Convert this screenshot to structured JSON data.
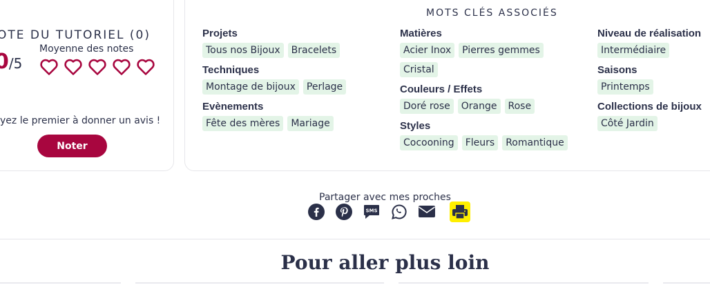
{
  "rating": {
    "title": "OTE DU TUTORIEL (0)",
    "score": "0",
    "max": "/5",
    "average_label": "Moyenne des notes",
    "hearts": 5,
    "cta_text": "yez le premier à donner un avis !",
    "button_label": "Noter",
    "accent_color": "#a8063f"
  },
  "keywords": {
    "title": "MOTS CLÉS ASSOCIÉS",
    "columns": [
      [
        {
          "label": "Projets",
          "tags": [
            "Tous nos Bijoux",
            "Bracelets"
          ]
        },
        {
          "label": "Techniques",
          "tags": [
            "Montage de bijoux",
            "Perlage"
          ]
        },
        {
          "label": "Evènements",
          "tags": [
            "Fête des mères",
            "Mariage"
          ]
        }
      ],
      [
        {
          "label": "Matières",
          "tags": [
            "Acier Inox",
            "Pierres gemmes",
            "Cristal"
          ]
        },
        {
          "label": "Couleurs / Effets",
          "tags": [
            "Doré rose",
            "Orange",
            "Rose"
          ]
        },
        {
          "label": "Styles",
          "tags": [
            "Cocooning",
            "Fleurs",
            "Romantique"
          ]
        }
      ],
      [
        {
          "label": "Niveau de réalisation",
          "tags": [
            "Intermédiaire"
          ]
        },
        {
          "label": "Saisons",
          "tags": [
            "Printemps"
          ]
        },
        {
          "label": "Collections de bijoux",
          "tags": [
            "Côté Jardin"
          ]
        }
      ]
    ],
    "tag_color": "#e3f4e7"
  },
  "share": {
    "label": "Partager avec mes proches",
    "icons": [
      "facebook-icon",
      "pinterest-icon",
      "sms-icon",
      "whatsapp-icon",
      "email-icon",
      "print-icon"
    ]
  },
  "more": {
    "title": "Pour aller plus loin"
  }
}
